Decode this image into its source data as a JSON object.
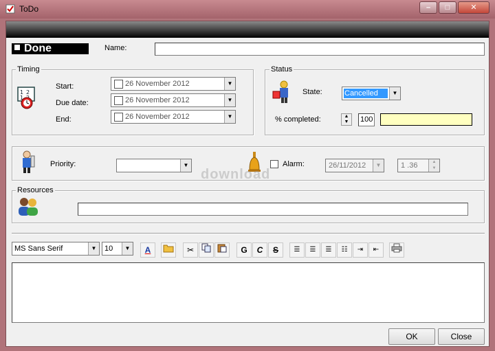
{
  "window": {
    "title": "ToDo"
  },
  "header": {
    "done_label": "Done",
    "name_label": "Name:",
    "name_value": ""
  },
  "timing": {
    "legend": "Timing",
    "start_label": "Start:",
    "start_value": "26 November 2012",
    "due_label": "Due date:",
    "due_value": "26 November 2012",
    "end_label": "End:",
    "end_value": "26 November 2012"
  },
  "status": {
    "legend": "Status",
    "state_label": "State:",
    "state_value": "Cancelled",
    "completed_label": "% completed:",
    "completed_value": "100",
    "color_hex": "#ffffc0"
  },
  "priority": {
    "label": "Priority:",
    "value": "",
    "alarm_label": "Alarm:",
    "alarm_date": "26/11/2012",
    "alarm_time": "1 .36"
  },
  "resources": {
    "legend": "Resources",
    "value": ""
  },
  "editor": {
    "font": "MS Sans Serif",
    "size": "10",
    "bold": "G",
    "italic": "C",
    "strike": "S",
    "content": ""
  },
  "footer": {
    "ok": "OK",
    "close": "Close"
  },
  "watermark": "download"
}
